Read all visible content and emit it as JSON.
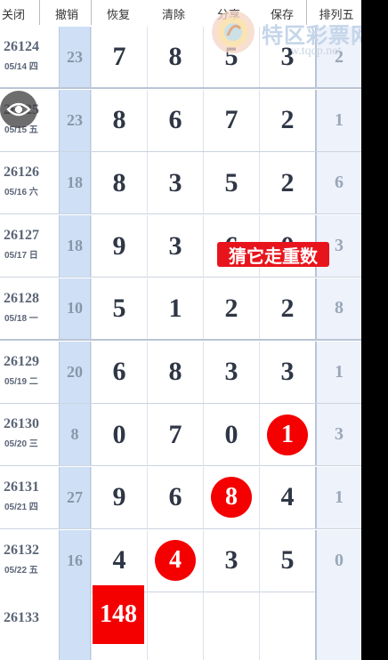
{
  "toolbar": {
    "buttons": [
      "关闭",
      "撤销",
      "恢复",
      "清除",
      "分享",
      "保存",
      "排列五"
    ]
  },
  "rows": [
    {
      "period": "26124",
      "date": "05/14 四",
      "sum": "23",
      "digits": [
        "7",
        "8",
        "5",
        "3"
      ],
      "p5": "2",
      "hits": [
        false,
        false,
        false,
        false
      ]
    },
    {
      "period": "26125",
      "date": "05/15 五",
      "sum": "23",
      "digits": [
        "8",
        "6",
        "7",
        "2"
      ],
      "p5": "1",
      "hits": [
        false,
        false,
        false,
        false
      ]
    },
    {
      "period": "26126",
      "date": "05/16 六",
      "sum": "18",
      "digits": [
        "8",
        "3",
        "5",
        "2"
      ],
      "p5": "6",
      "hits": [
        false,
        false,
        false,
        false
      ]
    },
    {
      "period": "26127",
      "date": "05/17 日",
      "sum": "18",
      "digits": [
        "9",
        "3",
        "6",
        "0"
      ],
      "p5": "3",
      "hits": [
        false,
        false,
        false,
        false
      ]
    },
    {
      "period": "26128",
      "date": "05/18 一",
      "sum": "10",
      "digits": [
        "5",
        "1",
        "2",
        "2"
      ],
      "p5": "8",
      "hits": [
        false,
        false,
        false,
        false
      ]
    },
    {
      "period": "26129",
      "date": "05/19 二",
      "sum": "20",
      "digits": [
        "6",
        "8",
        "3",
        "3"
      ],
      "p5": "1",
      "hits": [
        false,
        false,
        false,
        false
      ]
    },
    {
      "period": "26130",
      "date": "05/20 三",
      "sum": "8",
      "digits": [
        "0",
        "7",
        "0",
        "1"
      ],
      "p5": "3",
      "hits": [
        false,
        false,
        false,
        true
      ]
    },
    {
      "period": "26131",
      "date": "05/21 四",
      "sum": "27",
      "digits": [
        "9",
        "6",
        "8",
        "4"
      ],
      "p5": "1",
      "hits": [
        false,
        false,
        true,
        false
      ]
    },
    {
      "period": "26132",
      "date": "05/22 五",
      "sum": "16",
      "digits": [
        "4",
        "4",
        "3",
        "5"
      ],
      "p5": "0",
      "hits": [
        false,
        true,
        false,
        false
      ]
    }
  ],
  "next_row": {
    "period": "26133",
    "prediction": "148"
  },
  "overlay": {
    "guess_tag": "猜它走重数",
    "watermark_title": "特区彩票网",
    "watermark_url": "w.tqcp.net",
    "eye_icon": "eye-icon"
  },
  "colors": {
    "hit": "#f40000",
    "sum_col": "#cfe0f6",
    "tag": "#e8141c"
  }
}
